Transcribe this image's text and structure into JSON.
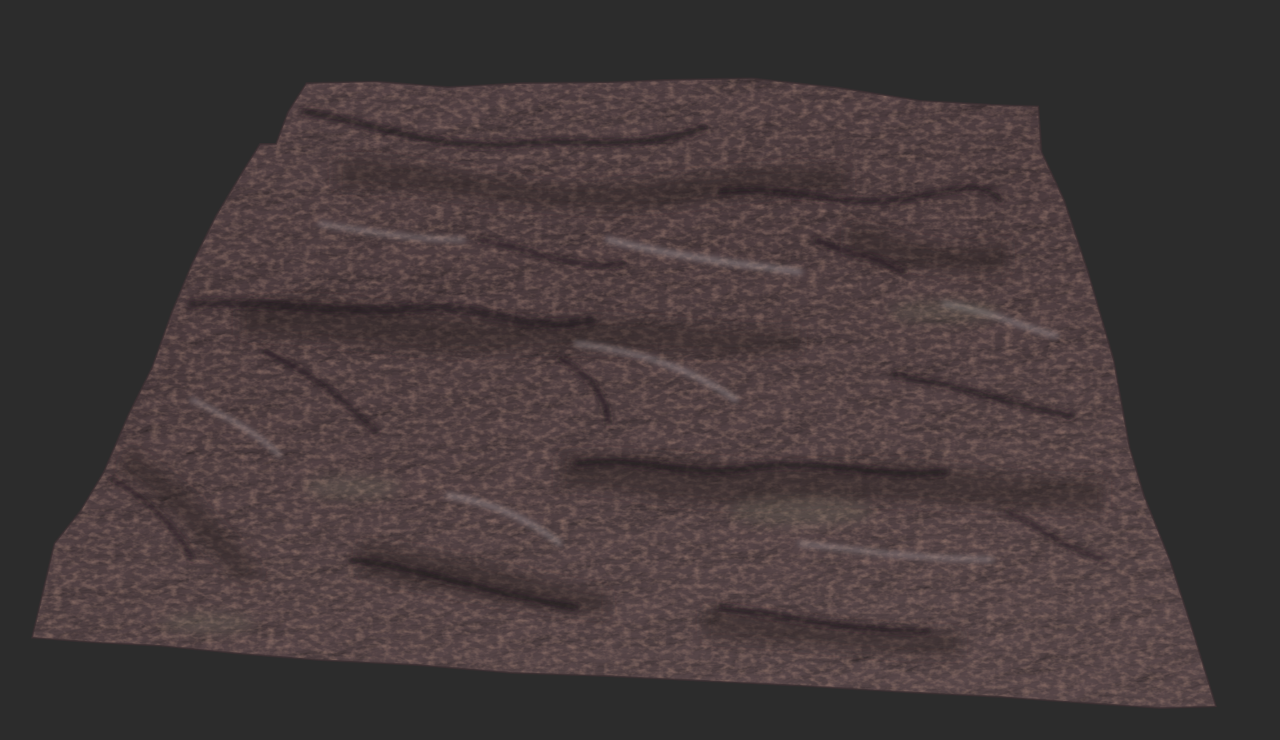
{
  "viewport": {
    "background_color": "#2c2c2c"
  },
  "terrain": {
    "subject": "terrain-heightmap-render",
    "palette": {
      "base": "#5a4a4c",
      "rock_light": "#9a8a8e",
      "rock_mid": "#6e5c60",
      "shadow": "#2a2224",
      "rust": "#b0664a",
      "highlight": "#b6adb0",
      "moss": "#7c8066"
    }
  }
}
